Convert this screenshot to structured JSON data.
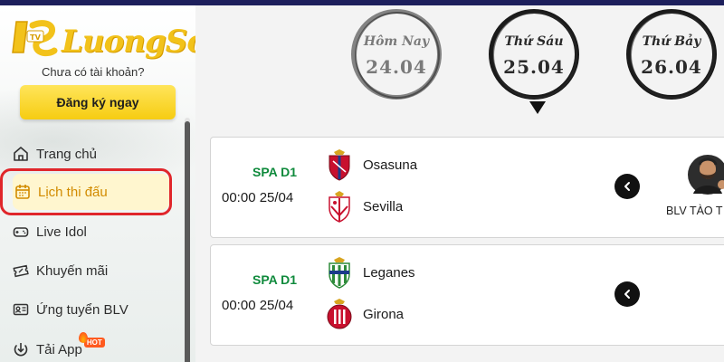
{
  "brand": {
    "name": "LuongSon",
    "mark": "TV"
  },
  "sidebar": {
    "no_account": "Chưa có tài khoản?",
    "signup": "Đăng ký ngay",
    "items": [
      {
        "label": "Trang chủ",
        "icon": "home-icon"
      },
      {
        "label": "Lịch thi đấu",
        "icon": "calendar-icon",
        "active": true
      },
      {
        "label": "Live Idol",
        "icon": "gamepad-icon"
      },
      {
        "label": "Khuyến mãi",
        "icon": "ticket-icon"
      },
      {
        "label": "Ứng tuyển BLV",
        "icon": "id-card-icon"
      },
      {
        "label": "Tải App",
        "icon": "download-icon",
        "badge": "HOT"
      }
    ]
  },
  "days": [
    {
      "top": "Hôm Nay",
      "date": "24.04",
      "selected": false
    },
    {
      "top": "Thứ Sáu",
      "date": "25.04",
      "selected": true
    },
    {
      "top": "Thứ Bảy",
      "date": "26.04",
      "selected": false
    }
  ],
  "matches": [
    {
      "league": "SPA D1",
      "time": "00:00 25/04",
      "home": "Osasuna",
      "away": "Sevilla",
      "commentator": "BLV TÀO T"
    },
    {
      "league": "SPA D1",
      "time": "00:00 25/04",
      "home": "Leganes",
      "away": "Girona"
    }
  ],
  "colors": {
    "accent": "#f6cc12",
    "league": "#0f8a3c",
    "highlight": "#e0262b",
    "active_text": "#d28b00"
  }
}
